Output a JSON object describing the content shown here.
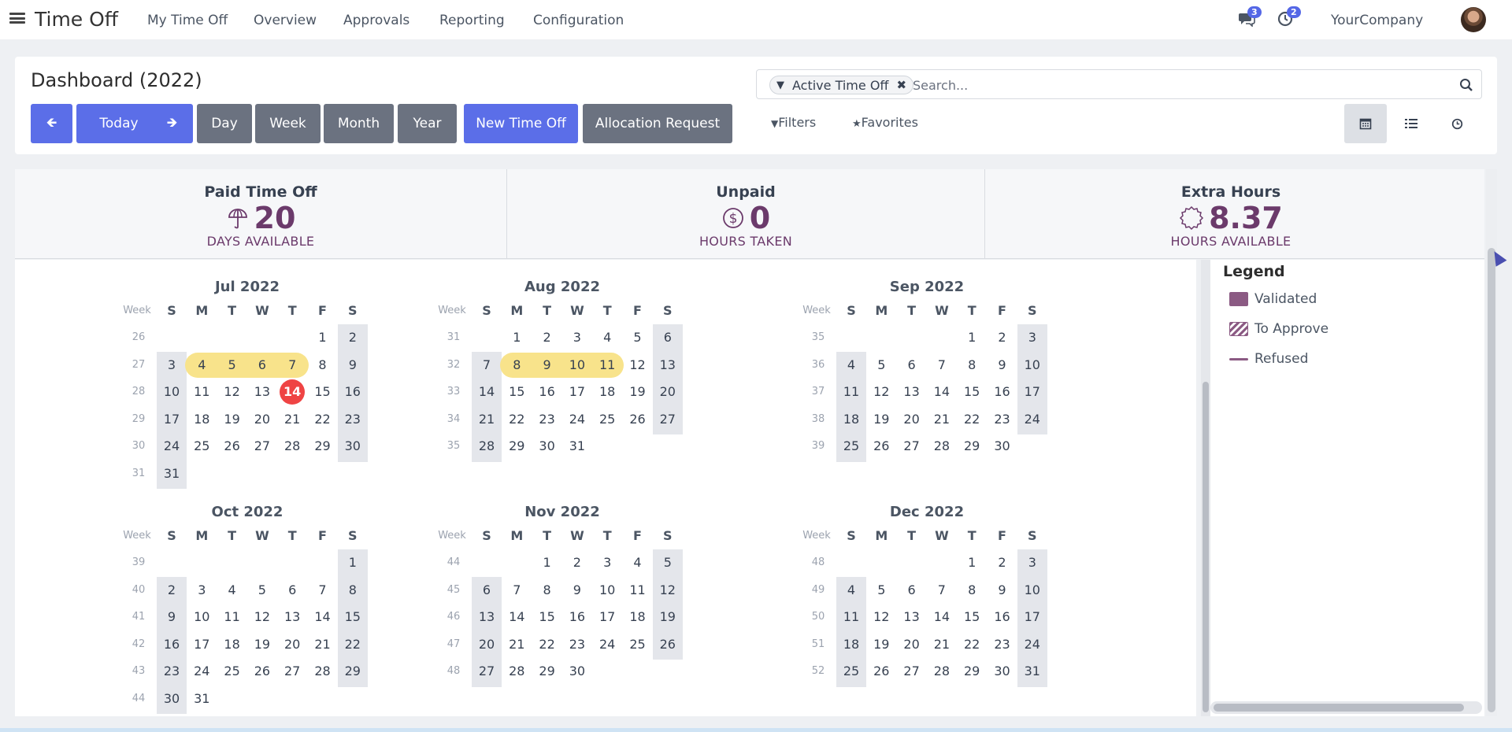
{
  "app": {
    "title": "Time Off"
  },
  "nav": [
    {
      "label": "My Time Off"
    },
    {
      "label": "Overview"
    },
    {
      "label": "Approvals"
    },
    {
      "label": "Reporting"
    },
    {
      "label": "Configuration"
    }
  ],
  "topbar": {
    "messages_badge": "3",
    "activities_badge": "2",
    "company": "YourCompany",
    "icons": {
      "menu": "hamburger-icon",
      "messages": "chat-icon",
      "activities": "clock-icon",
      "avatar": "user-avatar"
    }
  },
  "page": {
    "title": "Dashboard (2022)"
  },
  "buttons": {
    "prev": "🡸",
    "today": "Today",
    "next": "🡺",
    "day": "Day",
    "week": "Week",
    "month": "Month",
    "year": "Year",
    "new_time_off": "New Time Off",
    "allocation_request": "Allocation Request"
  },
  "search": {
    "facet_label": "Active Time Off",
    "placeholder": "Search...",
    "filters_label": "Filters",
    "favorites_label": "Favorites"
  },
  "views": {
    "calendar": "calendar-icon",
    "list": "list-icon",
    "activity": "clock-icon",
    "active": "calendar"
  },
  "stats": [
    {
      "title": "Paid Time Off",
      "value": "20",
      "unit": "DAYS AVAILABLE",
      "icon": "umbrella-icon"
    },
    {
      "title": "Unpaid",
      "value": "0",
      "unit": "HOURS TAKEN",
      "icon": "dollar-icon"
    },
    {
      "title": "Extra Hours",
      "value": "8.37",
      "unit": "HOURS AVAILABLE",
      "icon": "badge-icon"
    }
  ],
  "calendar": {
    "week_header": "Week",
    "weekday_headers": [
      "S",
      "M",
      "T",
      "W",
      "T",
      "F",
      "S"
    ],
    "months": [
      {
        "title": "Jul 2022",
        "weeks": [
          {
            "num": "26",
            "days": [
              "",
              "",
              "",
              "",
              "",
              "1",
              "2"
            ]
          },
          {
            "num": "27",
            "days": [
              "3",
              "4",
              "5",
              "6",
              "7",
              "8",
              "9"
            ]
          },
          {
            "num": "28",
            "days": [
              "10",
              "11",
              "12",
              "13",
              "14",
              "15",
              "16"
            ]
          },
          {
            "num": "29",
            "days": [
              "17",
              "18",
              "19",
              "20",
              "21",
              "22",
              "23"
            ]
          },
          {
            "num": "30",
            "days": [
              "24",
              "25",
              "26",
              "27",
              "28",
              "29",
              "30"
            ]
          },
          {
            "num": "31",
            "days": [
              "31",
              "",
              "",
              "",
              "",
              "",
              ""
            ]
          }
        ],
        "leave": [
          {
            "week": 1,
            "from": 1,
            "to": 4
          }
        ],
        "today": {
          "week": 2,
          "col": 4
        }
      },
      {
        "title": "Aug 2022",
        "weeks": [
          {
            "num": "31",
            "days": [
              "",
              "1",
              "2",
              "3",
              "4",
              "5",
              "6"
            ]
          },
          {
            "num": "32",
            "days": [
              "7",
              "8",
              "9",
              "10",
              "11",
              "12",
              "13"
            ]
          },
          {
            "num": "33",
            "days": [
              "14",
              "15",
              "16",
              "17",
              "18",
              "19",
              "20"
            ]
          },
          {
            "num": "34",
            "days": [
              "21",
              "22",
              "23",
              "24",
              "25",
              "26",
              "27"
            ]
          },
          {
            "num": "35",
            "days": [
              "28",
              "29",
              "30",
              "31",
              "",
              "",
              ""
            ]
          }
        ],
        "leave": [
          {
            "week": 1,
            "from": 1,
            "to": 4
          }
        ]
      },
      {
        "title": "Sep 2022",
        "weeks": [
          {
            "num": "35",
            "days": [
              "",
              "",
              "",
              "",
              "1",
              "2",
              "3"
            ]
          },
          {
            "num": "36",
            "days": [
              "4",
              "5",
              "6",
              "7",
              "8",
              "9",
              "10"
            ]
          },
          {
            "num": "37",
            "days": [
              "11",
              "12",
              "13",
              "14",
              "15",
              "16",
              "17"
            ]
          },
          {
            "num": "38",
            "days": [
              "18",
              "19",
              "20",
              "21",
              "22",
              "23",
              "24"
            ]
          },
          {
            "num": "39",
            "days": [
              "25",
              "26",
              "27",
              "28",
              "29",
              "30",
              ""
            ]
          }
        ]
      },
      {
        "title": "Oct 2022",
        "weeks": [
          {
            "num": "39",
            "days": [
              "",
              "",
              "",
              "",
              "",
              "",
              "1"
            ]
          },
          {
            "num": "40",
            "days": [
              "2",
              "3",
              "4",
              "5",
              "6",
              "7",
              "8"
            ]
          },
          {
            "num": "41",
            "days": [
              "9",
              "10",
              "11",
              "12",
              "13",
              "14",
              "15"
            ]
          },
          {
            "num": "42",
            "days": [
              "16",
              "17",
              "18",
              "19",
              "20",
              "21",
              "22"
            ]
          },
          {
            "num": "43",
            "days": [
              "23",
              "24",
              "25",
              "26",
              "27",
              "28",
              "29"
            ]
          },
          {
            "num": "44",
            "days": [
              "30",
              "31",
              "",
              "",
              "",
              "",
              ""
            ]
          }
        ]
      },
      {
        "title": "Nov 2022",
        "weeks": [
          {
            "num": "44",
            "days": [
              "",
              "",
              "1",
              "2",
              "3",
              "4",
              "5"
            ]
          },
          {
            "num": "45",
            "days": [
              "6",
              "7",
              "8",
              "9",
              "10",
              "11",
              "12"
            ]
          },
          {
            "num": "46",
            "days": [
              "13",
              "14",
              "15",
              "16",
              "17",
              "18",
              "19"
            ]
          },
          {
            "num": "47",
            "days": [
              "20",
              "21",
              "22",
              "23",
              "24",
              "25",
              "26"
            ]
          },
          {
            "num": "48",
            "days": [
              "27",
              "28",
              "29",
              "30",
              "",
              "",
              ""
            ]
          }
        ]
      },
      {
        "title": "Dec 2022",
        "weeks": [
          {
            "num": "48",
            "days": [
              "",
              "",
              "",
              "",
              "1",
              "2",
              "3"
            ]
          },
          {
            "num": "49",
            "days": [
              "4",
              "5",
              "6",
              "7",
              "8",
              "9",
              "10"
            ]
          },
          {
            "num": "50",
            "days": [
              "11",
              "12",
              "13",
              "14",
              "15",
              "16",
              "17"
            ]
          },
          {
            "num": "51",
            "days": [
              "18",
              "19",
              "20",
              "21",
              "22",
              "23",
              "24"
            ]
          },
          {
            "num": "52",
            "days": [
              "25",
              "26",
              "27",
              "28",
              "29",
              "30",
              "31"
            ]
          }
        ]
      }
    ]
  },
  "legend": {
    "title": "Legend",
    "items": [
      {
        "label": "Validated",
        "style": "solid",
        "color": "#8b5a83"
      },
      {
        "label": "To Approve",
        "style": "striped",
        "color": "#8b5a83"
      },
      {
        "label": "Refused",
        "style": "line",
        "color": "#8b5a83"
      }
    ]
  },
  "colors": {
    "primary": "#5b6ee8",
    "secondary": "#6b7280",
    "accent": "#6b3a6b",
    "leave_highlight": "#f8e38b",
    "today": "#ef4444",
    "weekend": "#e4e6eb"
  }
}
